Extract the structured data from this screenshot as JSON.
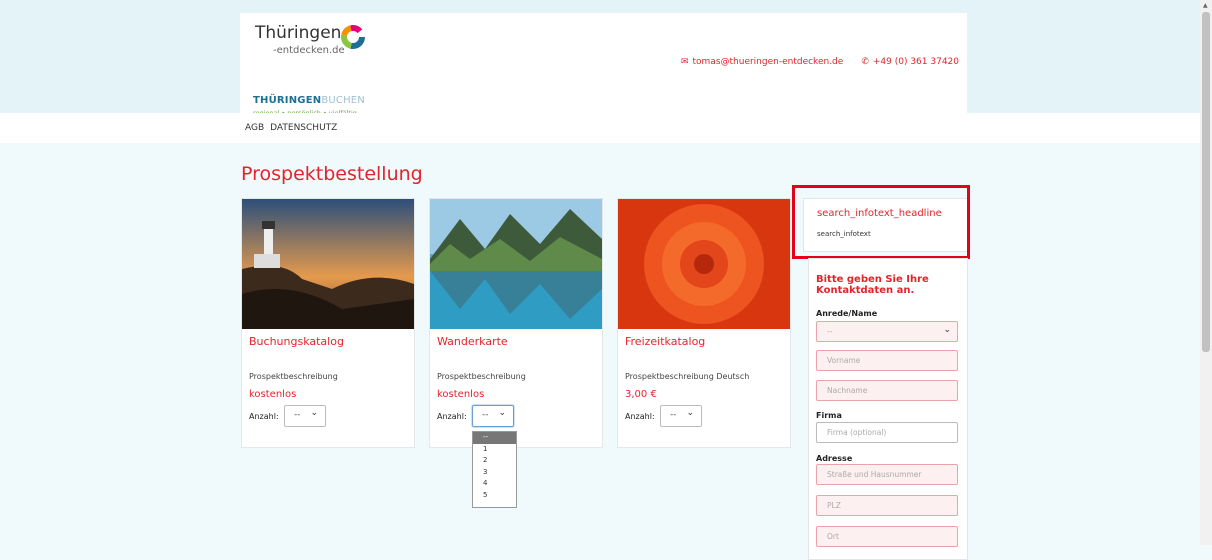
{
  "header": {
    "logo_text": "Thüringen",
    "logo_sub": "-entdecken.de",
    "brand_bold": "THÜRINGEN",
    "brand_light": "BUCHEN",
    "brand_tagline": "regional • persönlich • vielfältig",
    "email": "tomas@thueringen-entdecken.de",
    "phone": "+49 (0) 361 37420"
  },
  "nav": {
    "agb": "AGB",
    "datenschutz": "DATENSCHUTZ"
  },
  "page": {
    "title": "Prospektbestellung"
  },
  "qty_label": "Anzahl:",
  "cards": [
    {
      "title": "Buchungskatalog",
      "desc": "Prospektbeschreibung",
      "price": "kostenlos",
      "qty": "--"
    },
    {
      "title": "Wanderkarte",
      "desc": "Prospektbeschreibung",
      "price": "kostenlos",
      "qty": "--"
    },
    {
      "title": "Freizeitkatalog",
      "desc": "Prospektbeschreibung Deutsch",
      "price": "3,00 €",
      "qty": "--"
    }
  ],
  "dropdown": {
    "options": [
      "--",
      "1",
      "2",
      "3",
      "4",
      "5"
    ]
  },
  "info": {
    "headline": "search_infotext_headline",
    "text": "search_infotext"
  },
  "form": {
    "heading": "Bitte geben Sie Ihre Kontaktdaten an.",
    "anrede_label": "Anrede/Name",
    "anrede_value": "--",
    "vorname_ph": "Vorname",
    "nachname_ph": "Nachname",
    "firma_label": "Firma",
    "firma_ph": "Firma (optional)",
    "adresse_label": "Adresse",
    "strasse_ph": "Straße und Hausnummer",
    "plz_ph": "PLZ",
    "ort_ph": "Ort"
  },
  "colors": {
    "accent": "#e3242b",
    "highlight_box": "#e3001b",
    "brand_blue": "#1f6e93"
  }
}
